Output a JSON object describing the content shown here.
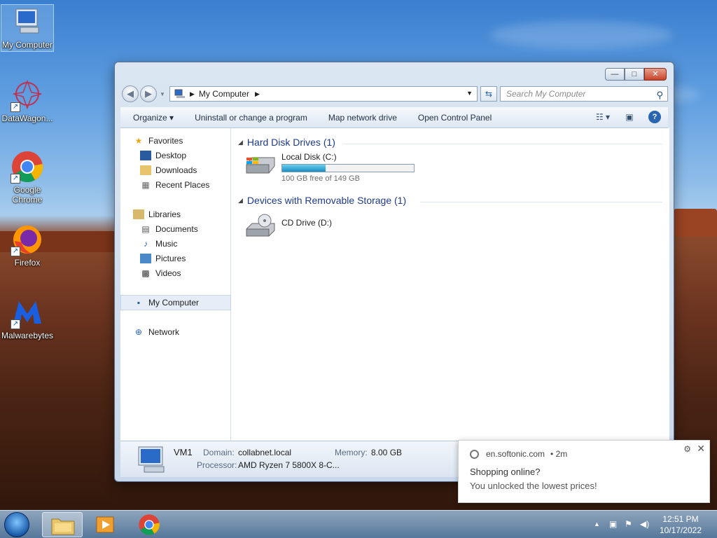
{
  "desktop": {
    "icons": [
      {
        "label": "My Computer"
      },
      {
        "label": "DataWagon..."
      },
      {
        "label": "Google Chrome"
      },
      {
        "label": "Firefox"
      },
      {
        "label": "Malwarebytes"
      }
    ]
  },
  "window": {
    "controls": {
      "minimize": "—",
      "maximize": "□",
      "close": "✕"
    },
    "address": {
      "location": "My Computer",
      "separator": "▶"
    },
    "search_placeholder": "Search My Computer",
    "toolbar": {
      "organize": "Organize ▾",
      "uninstall": "Uninstall or change a program",
      "map_drive": "Map network drive",
      "control_panel": "Open Control Panel"
    },
    "nav": {
      "favorites": "Favorites",
      "desktop": "Desktop",
      "downloads": "Downloads",
      "recent": "Recent Places",
      "libraries": "Libraries",
      "documents": "Documents",
      "music": "Music",
      "pictures": "Pictures",
      "videos": "Videos",
      "my_computer": "My Computer",
      "network": "Network"
    },
    "groups": {
      "hdd": "Hard Disk Drives (1)",
      "removable": "Devices with Removable Storage (1)"
    },
    "drives": {
      "c_name": "Local Disk (C:)",
      "c_free": "100 GB free of 149 GB",
      "c_used_fraction": 0.33,
      "d_name": "CD Drive (D:)"
    },
    "details": {
      "name": "VM1",
      "domain_label": "Domain:",
      "domain": "collabnet.local",
      "memory_label": "Memory:",
      "memory": "8.00 GB",
      "processor_label": "Processor:",
      "processor": "AMD Ryzen 7 5800X 8-C..."
    }
  },
  "notification": {
    "source": "en.softonic.com",
    "time": "• 2m",
    "title": "Shopping online?",
    "body": "You unlocked the lowest prices!"
  },
  "taskbar": {
    "time": "12:51 PM",
    "date": "10/17/2022"
  }
}
